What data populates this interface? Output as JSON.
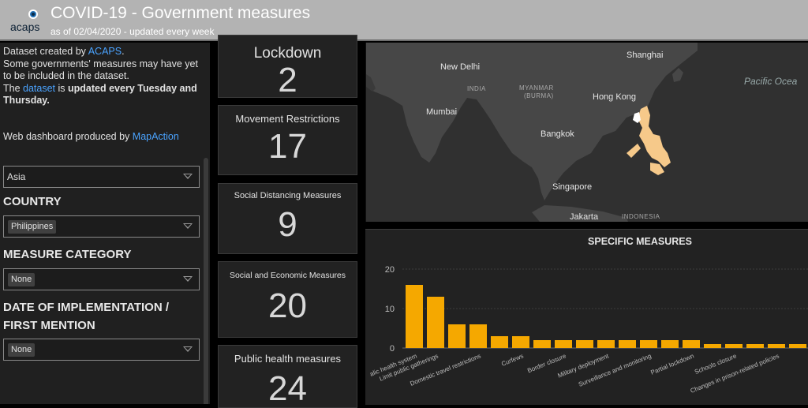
{
  "header": {
    "logo_text": "acaps",
    "title": "COVID-19 - Government measures",
    "subtitle": "as of 02/04/2020 - updated every week"
  },
  "sidebar": {
    "info_line1_prefix": "Dataset created by ",
    "info_line1_link": "ACAPS",
    "info_line1_suffix": ".",
    "info_line2": "Some governments' measures may have yet to be included in the dataset.",
    "info_line3_prefix": "The ",
    "info_line3_link": "dataset",
    "info_line3_mid": " is ",
    "info_line3_bold": "updated every Tuesday and Thursday.",
    "credit_prefix": "Web dashboard produced by ",
    "credit_link": "MapAction",
    "region_value": "Asia",
    "country_label": "COUNTRY",
    "country_value": "Philippines",
    "measure_label": "MEASURE CATEGORY",
    "measure_value": "None",
    "date_label": "DATE OF IMPLEMENTATION / FIRST MENTION",
    "date_value": "None"
  },
  "tiles": [
    {
      "label": "Lockdown",
      "value": "2"
    },
    {
      "label": "Movement Restrictions",
      "value": "17"
    },
    {
      "label": "Social Distancing Measures",
      "value": "9"
    },
    {
      "label": "Social and Economic Measures",
      "value": "20"
    },
    {
      "label": "Public health measures",
      "value": "24"
    }
  ],
  "map": {
    "cities": [
      "Shanghai",
      "New Delhi",
      "Hong Kong",
      "Mumbai",
      "Bangkok",
      "Singapore",
      "Jakarta"
    ],
    "countries": [
      "INDIA",
      "MYANMAR",
      "(BURMA)",
      "INDONESIA"
    ],
    "ocean": "Pacific Ocea",
    "highlight_color": "#f6c98a"
  },
  "chart_data": {
    "type": "bar",
    "title": "SPECIFIC MEASURES",
    "ylim": [
      0,
      20
    ],
    "yticks": [
      0,
      10,
      20
    ],
    "grid": true,
    "bar_color": "#f5a800",
    "categories": [
      "Public health system",
      "Limit public gatherings",
      "",
      "Domestic travel restrictions",
      "",
      "Curfews",
      "",
      "Border closure",
      "",
      "Military deployment",
      "",
      "Surveillance and monitoring",
      "",
      "Partial lockdown",
      "",
      "Schools closure",
      "",
      "Changes in prison-related policies",
      ""
    ],
    "tick_labels": [
      "alic health system",
      "Limit public gatherings",
      "Domestic travel restrictions",
      "Curfews",
      "Border closure",
      "Military deployment",
      "Surveillance and monitoring",
      "Partial lockdown",
      "Schools closure",
      "Changes in prison-related policies"
    ],
    "values": [
      16,
      13,
      6,
      6,
      3,
      3,
      2,
      2,
      2,
      2,
      2,
      2,
      2,
      2,
      1,
      1,
      1,
      1,
      1
    ]
  }
}
